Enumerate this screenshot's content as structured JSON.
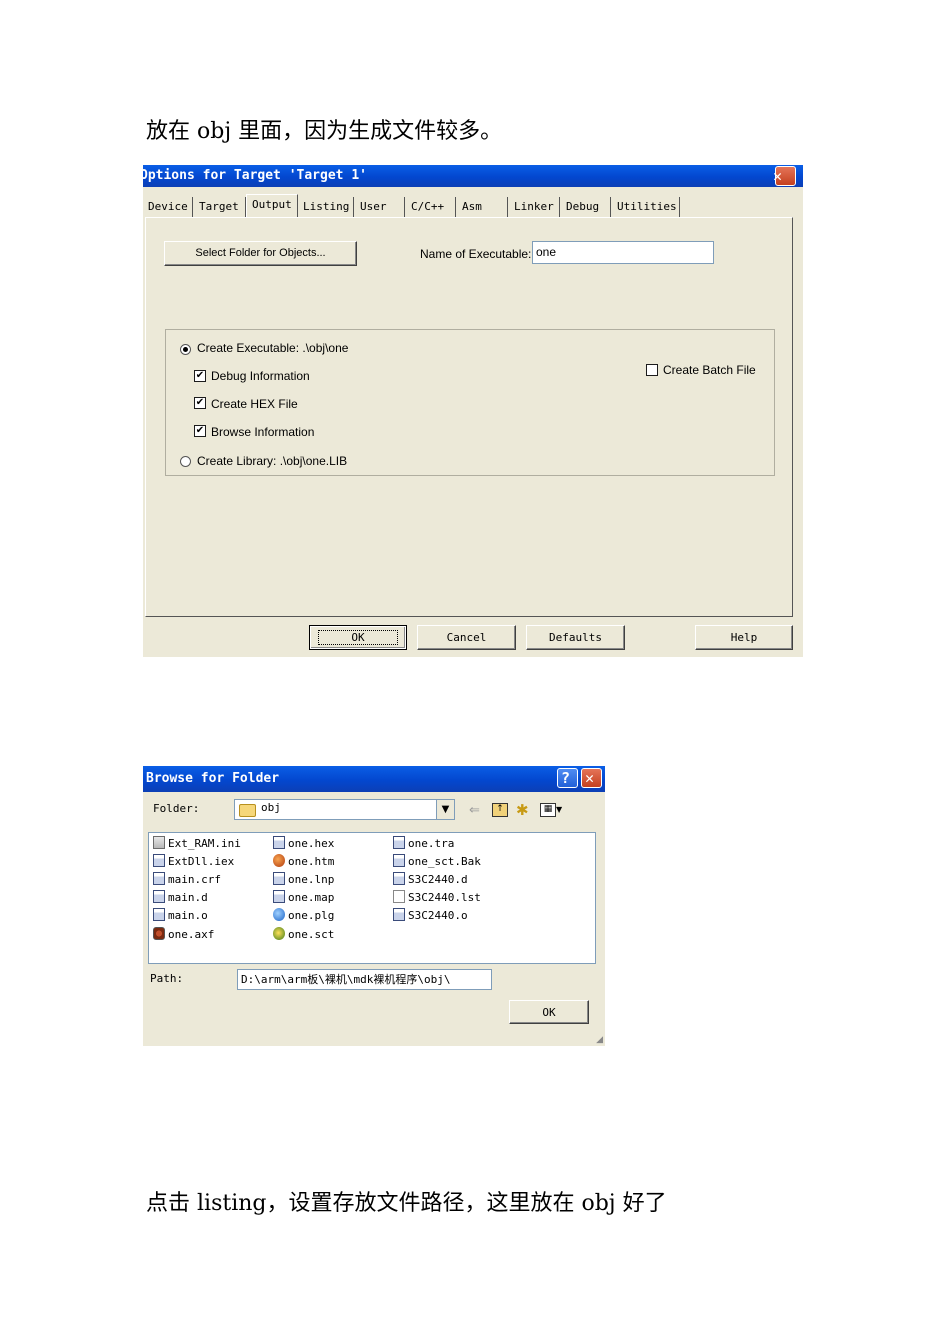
{
  "top_text": "放在 obj 里面，因为生成文件较多。",
  "bottom_text": "点击 listing，设置存放文件路径，这里放在 obj 好了",
  "options_dialog": {
    "title": "Options for Target 'Target 1'",
    "close_symbol": "✕",
    "tabs": [
      "Device",
      "Target",
      "Output",
      "Listing",
      "User",
      "C/C++",
      "Asm",
      "Linker",
      "Debug",
      "Utilities"
    ],
    "selected_tab": "Output",
    "select_folder_button": "Select Folder for Objects...",
    "name_of_executable_label": "Name of Executable:",
    "name_of_executable_value": "one",
    "create_executable_label": "Create Executable:  .\\obj\\one",
    "create_executable_selected": true,
    "debug_info_label": "Debug Information",
    "debug_info_checked": true,
    "create_hex_label": "Create HEX File",
    "create_hex_checked": true,
    "browse_info_label": "Browse Information",
    "browse_info_checked": true,
    "create_library_label": "Create Library:  .\\obj\\one.LIB",
    "create_batch_label": "Create Batch File",
    "create_batch_checked": false,
    "ok_button": "OK",
    "cancel_button": "Cancel",
    "defaults_button": "Defaults",
    "help_button": "Help",
    "check_glyph": "✔"
  },
  "browse_dialog": {
    "title": "Browse for Folder",
    "help_symbol": "?",
    "close_symbol": "✕",
    "folder_label": "Folder:",
    "folder_value": "obj",
    "files": [
      {
        "name": "Ext_RAM.ini",
        "icon": "ini-icon"
      },
      {
        "name": "ExtDll.iex",
        "icon": "file-icon"
      },
      {
        "name": "main.crf",
        "icon": "file-icon"
      },
      {
        "name": "main.d",
        "icon": "file-icon"
      },
      {
        "name": "main.o",
        "icon": "file-icon"
      },
      {
        "name": "one.axf",
        "icon": "axf-icon"
      },
      {
        "name": "one.hex",
        "icon": "file-icon"
      },
      {
        "name": "one.htm",
        "icon": "browser-icon"
      },
      {
        "name": "one.lnp",
        "icon": "file-icon"
      },
      {
        "name": "one.map",
        "icon": "file-icon"
      },
      {
        "name": "one.plg",
        "icon": "ie-icon"
      },
      {
        "name": "one.sct",
        "icon": "sct-icon"
      },
      {
        "name": "one.tra",
        "icon": "file-icon"
      },
      {
        "name": "one_sct.Bak",
        "icon": "file-icon"
      },
      {
        "name": "S3C2440.d",
        "icon": "file-icon"
      },
      {
        "name": "S3C2440.lst",
        "icon": "text-file-icon"
      },
      {
        "name": "S3C2440.o",
        "icon": "file-icon"
      }
    ],
    "path_label": "Path:",
    "path_value": "D:\\arm\\arm板\\裸机\\mdk裸机程序\\obj\\",
    "ok_button": "OK"
  }
}
